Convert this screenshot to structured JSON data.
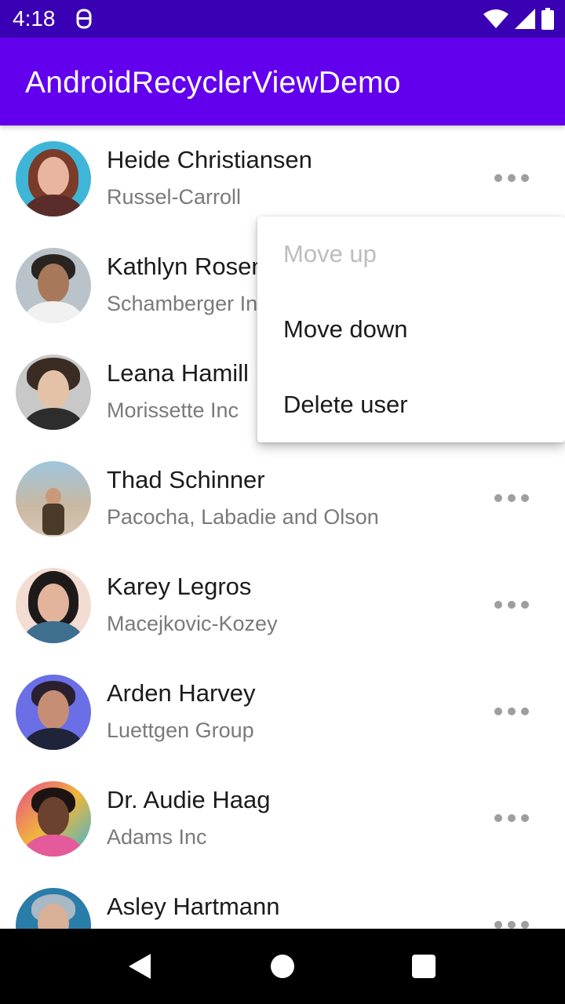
{
  "status_bar": {
    "time": "4:18",
    "icons": [
      "notification-icon",
      "wifi-icon",
      "signal-icon",
      "battery-icon"
    ]
  },
  "app_bar": {
    "title": "AndroidRecyclerViewDemo",
    "color": "#6200ee",
    "status_color": "#3a00b3"
  },
  "users": [
    {
      "name": "Heide Christiansen",
      "company": "Russel-Carroll"
    },
    {
      "name": "Kathlyn Rosen",
      "company": "Schamberger Inc"
    },
    {
      "name": "Leana Hamill",
      "company": "Morissette Inc"
    },
    {
      "name": "Thad Schinner",
      "company": "Pacocha, Labadie and Olson"
    },
    {
      "name": "Karey Legros",
      "company": "Macejkovic-Kozey"
    },
    {
      "name": "Arden Harvey",
      "company": "Luettgen Group"
    },
    {
      "name": "Dr. Audie Haag",
      "company": "Adams Inc"
    },
    {
      "name": "Asley Hartmann",
      "company": ""
    }
  ],
  "menu": {
    "items": [
      {
        "label": "Move up",
        "enabled": false
      },
      {
        "label": "Move down",
        "enabled": true
      },
      {
        "label": "Delete user",
        "enabled": true
      }
    ]
  },
  "nav_bar": {
    "icons": [
      "back-icon",
      "home-icon",
      "recents-icon"
    ]
  }
}
